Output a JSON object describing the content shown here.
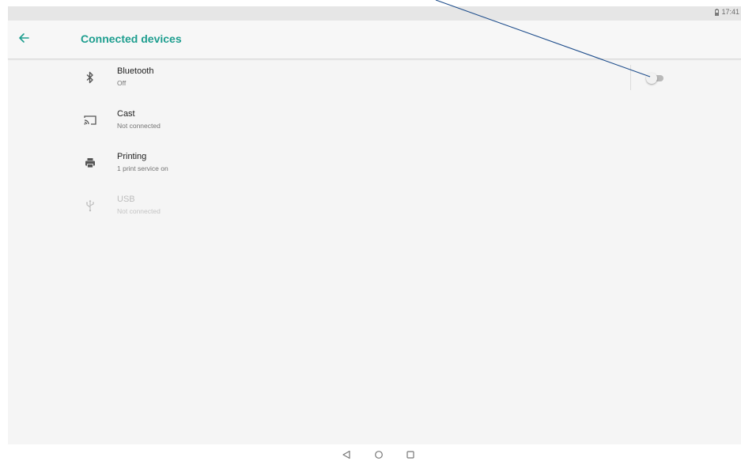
{
  "status_bar": {
    "time": "17:41",
    "battery_icon": "battery-icon"
  },
  "app_bar": {
    "back_icon": "arrow-back-icon",
    "title": "Connected devices"
  },
  "items": [
    {
      "title": "Bluetooth",
      "summary": "Off",
      "icon": "bluetooth-icon",
      "toggle_on": false
    },
    {
      "title": "Cast",
      "summary": "Not connected",
      "icon": "cast-icon"
    },
    {
      "title": "Printing",
      "summary": "1 print service on",
      "icon": "print-icon"
    },
    {
      "title": "USB",
      "summary": "Not connected",
      "icon": "usb-icon",
      "disabled": true
    }
  ],
  "nav_bar": {
    "buttons": [
      "back-nav-icon",
      "home-nav-icon",
      "recents-nav-icon"
    ]
  },
  "colors": {
    "accent": "#1e9e8f",
    "annotation_line": "#1f4e8c"
  }
}
